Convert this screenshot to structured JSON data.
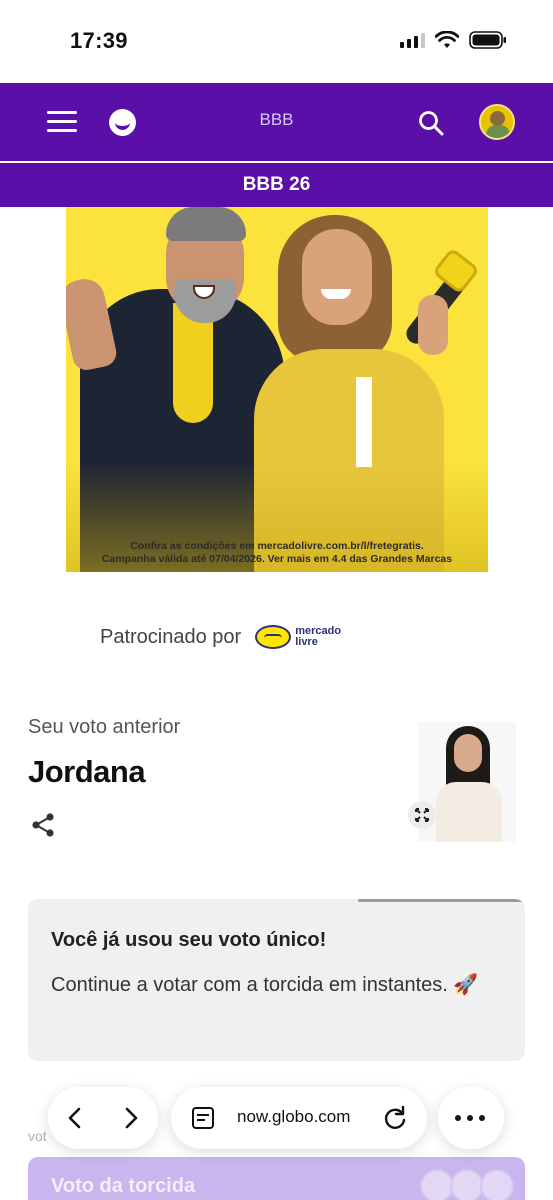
{
  "status_bar": {
    "time": "17:39"
  },
  "header": {
    "title": "BBB",
    "subtitle": "BBB 26"
  },
  "ad": {
    "fine_print_line1": "Confira as condições em mercadolivre.com.br/l/fretegratis.",
    "fine_print_line2": "Campanha válida até 07/04/2026. Ver mais em 4.4 das Grandes Marcas"
  },
  "sponsor": {
    "label": "Patrocinado por",
    "brand_line1": "mercado",
    "brand_line2": "livre",
    "brand_color": "#2d3277",
    "brand_accent": "#ffe600"
  },
  "previous_vote": {
    "label": "Seu voto anterior",
    "name": "Jordana"
  },
  "info_card": {
    "title": "Você já usou seu voto único!",
    "body": "Continue a votar com a torcida em instantes. 🚀"
  },
  "bottom": {
    "hint": "vot",
    "torcida_title": "Voto da torcida"
  },
  "browser": {
    "url": "now.globo.com"
  },
  "colors": {
    "header_purple": "#5a0fa8",
    "ad_yellow": "#fbe23c",
    "card_bg": "#f0f0f0"
  },
  "icons": [
    "menu-icon",
    "globo-logo-icon",
    "search-icon",
    "avatar",
    "share-icon",
    "expand-icon",
    "back-icon",
    "forward-icon",
    "tabs-icon",
    "reload-icon",
    "more-icon"
  ]
}
